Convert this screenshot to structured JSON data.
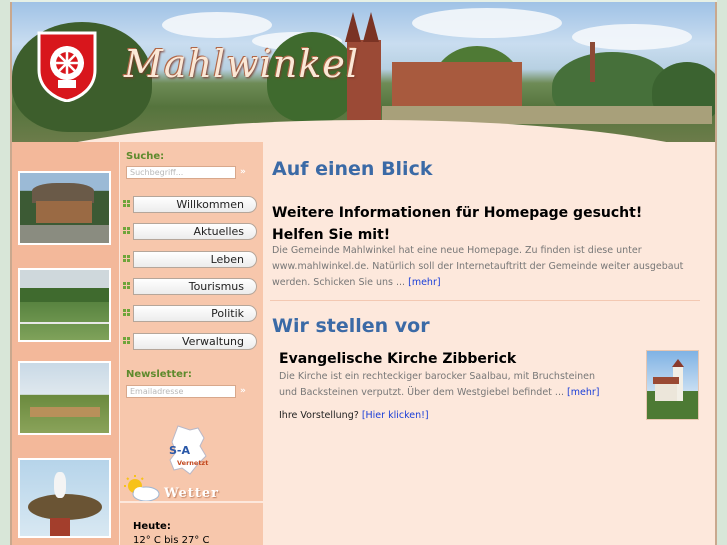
{
  "header": {
    "logo_text": "Mahlwinkel"
  },
  "sidebar": {
    "search_label": "Suche:",
    "search_placeholder": "Suchbegriff...",
    "nav_items": [
      {
        "label": "Willkommen"
      },
      {
        "label": "Aktuelles"
      },
      {
        "label": "Leben"
      },
      {
        "label": "Tourismus"
      },
      {
        "label": "Politik"
      },
      {
        "label": "Verwaltung"
      }
    ],
    "newsletter_label": "Newsletter:",
    "newsletter_placeholder": "Emailadresse",
    "go_symbol": "»",
    "sa_logo_line1": "S-A",
    "sa_logo_line2": "Vernetzt",
    "weather_word": "Wetter",
    "today_label": "Heute:",
    "temperature": "12° C bis 27° C"
  },
  "main": {
    "section1_title": "Auf einen Blick",
    "news_title": "Weitere Informationen für Homepage gesucht! Helfen Sie mit!",
    "news_text": "Die Gemeinde Mahlwinkel hat eine neue Homepage. Zu finden ist diese unter www.mahlwinkel.de. Natürlich soll der Internetauftritt der Gemeinde weiter ausgebaut werden. Schicken Sie uns ...",
    "news_more": "[mehr]",
    "section2_title": "Wir stellen vor",
    "feature_title": "Evangelische Kirche Zibberick",
    "feature_text": "Die Kirche ist ein rechteckiger barocker Saalbau, mit Bruchsteinen und Backsteinen verputzt. Über dem Westgiebel befindet ...",
    "feature_more": "[mehr]",
    "cta_text": "Ihre Vorstellung?",
    "cta_link": "[Hier klicken!]"
  },
  "colors": {
    "heading_blue": "#3b6aa6",
    "link_blue": "#1a3ed8",
    "accent_green": "#5d8a2c",
    "panel_peach": "#fde8dc"
  }
}
